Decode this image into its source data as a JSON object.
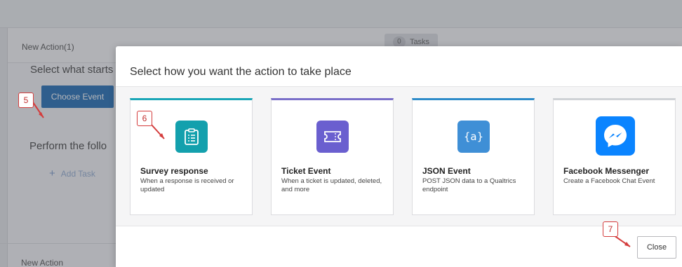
{
  "background": {
    "action_title": "New Action(1)",
    "tasks_count": "0",
    "tasks_label": "Tasks",
    "select_heading": "Select what starts",
    "choose_event_button": "Choose Event",
    "perform_heading": "Perform the follo",
    "add_task_icon": "+",
    "add_task_label": "Add Task",
    "next_action_title": "New Action"
  },
  "modal": {
    "title": "Select how you want the action to take place",
    "cards": [
      {
        "name": "Survey response",
        "description": "When a response is received or updated",
        "icon": "clipboard-list-icon",
        "accent": "#1aa6b7",
        "icon_bg": "#13a0ad"
      },
      {
        "name": "Ticket Event",
        "description": "When a ticket is updated, deleted, and more",
        "icon": "ticket-icon",
        "accent": "#7a6fc9",
        "icon_bg": "#6a5fcf"
      },
      {
        "name": "JSON Event",
        "description": "POST JSON data to a Qualtrics endpoint",
        "icon": "json-braces-icon",
        "accent": "#2e8bc9",
        "icon_bg": "#3f8fd6",
        "icon_text": "{a}"
      },
      {
        "name": "Facebook Messenger",
        "description": "Create a Facebook Chat Event",
        "icon": "messenger-icon",
        "accent": "#cfd2d6",
        "icon_bg": "#0a84ff"
      }
    ],
    "close_button": "Close"
  },
  "callouts": [
    "5",
    "6",
    "7"
  ]
}
